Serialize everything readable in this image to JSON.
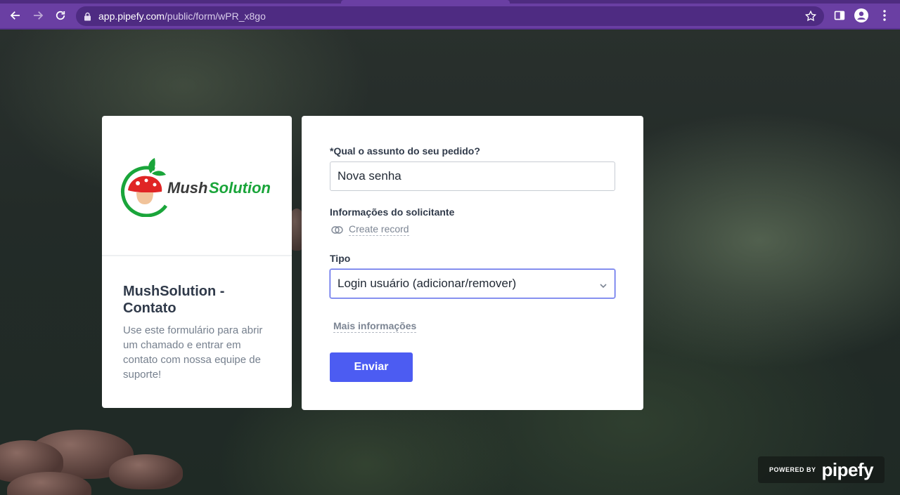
{
  "browser": {
    "url_domain": "app.pipefy.com",
    "url_path": "/public/form/wPR_x8go"
  },
  "brand": {
    "logo_text_dark": "Mush",
    "logo_text_green": "Solution",
    "colors": {
      "logo_red": "#e02525",
      "logo_green": "#1aa53a",
      "submit": "#4c5cf2"
    }
  },
  "info_card": {
    "title": "MushSolution - Contato",
    "description": "Use este formulário para abrir um chamado e entrar em contato com nossa equipe de suporte!"
  },
  "form": {
    "subject_label": "*Qual o assunto do seu pedido?",
    "subject_value": "Nova senha",
    "requester_label": "Informações do solicitante",
    "create_record_label": "Create record",
    "type_label": "Tipo",
    "type_value": "Login usuário (adicionar/remover)",
    "more_info_label": "Mais informações",
    "submit_label": "Enviar"
  },
  "footer": {
    "powered_by": "POWERED BY",
    "brand": "pipefy"
  }
}
